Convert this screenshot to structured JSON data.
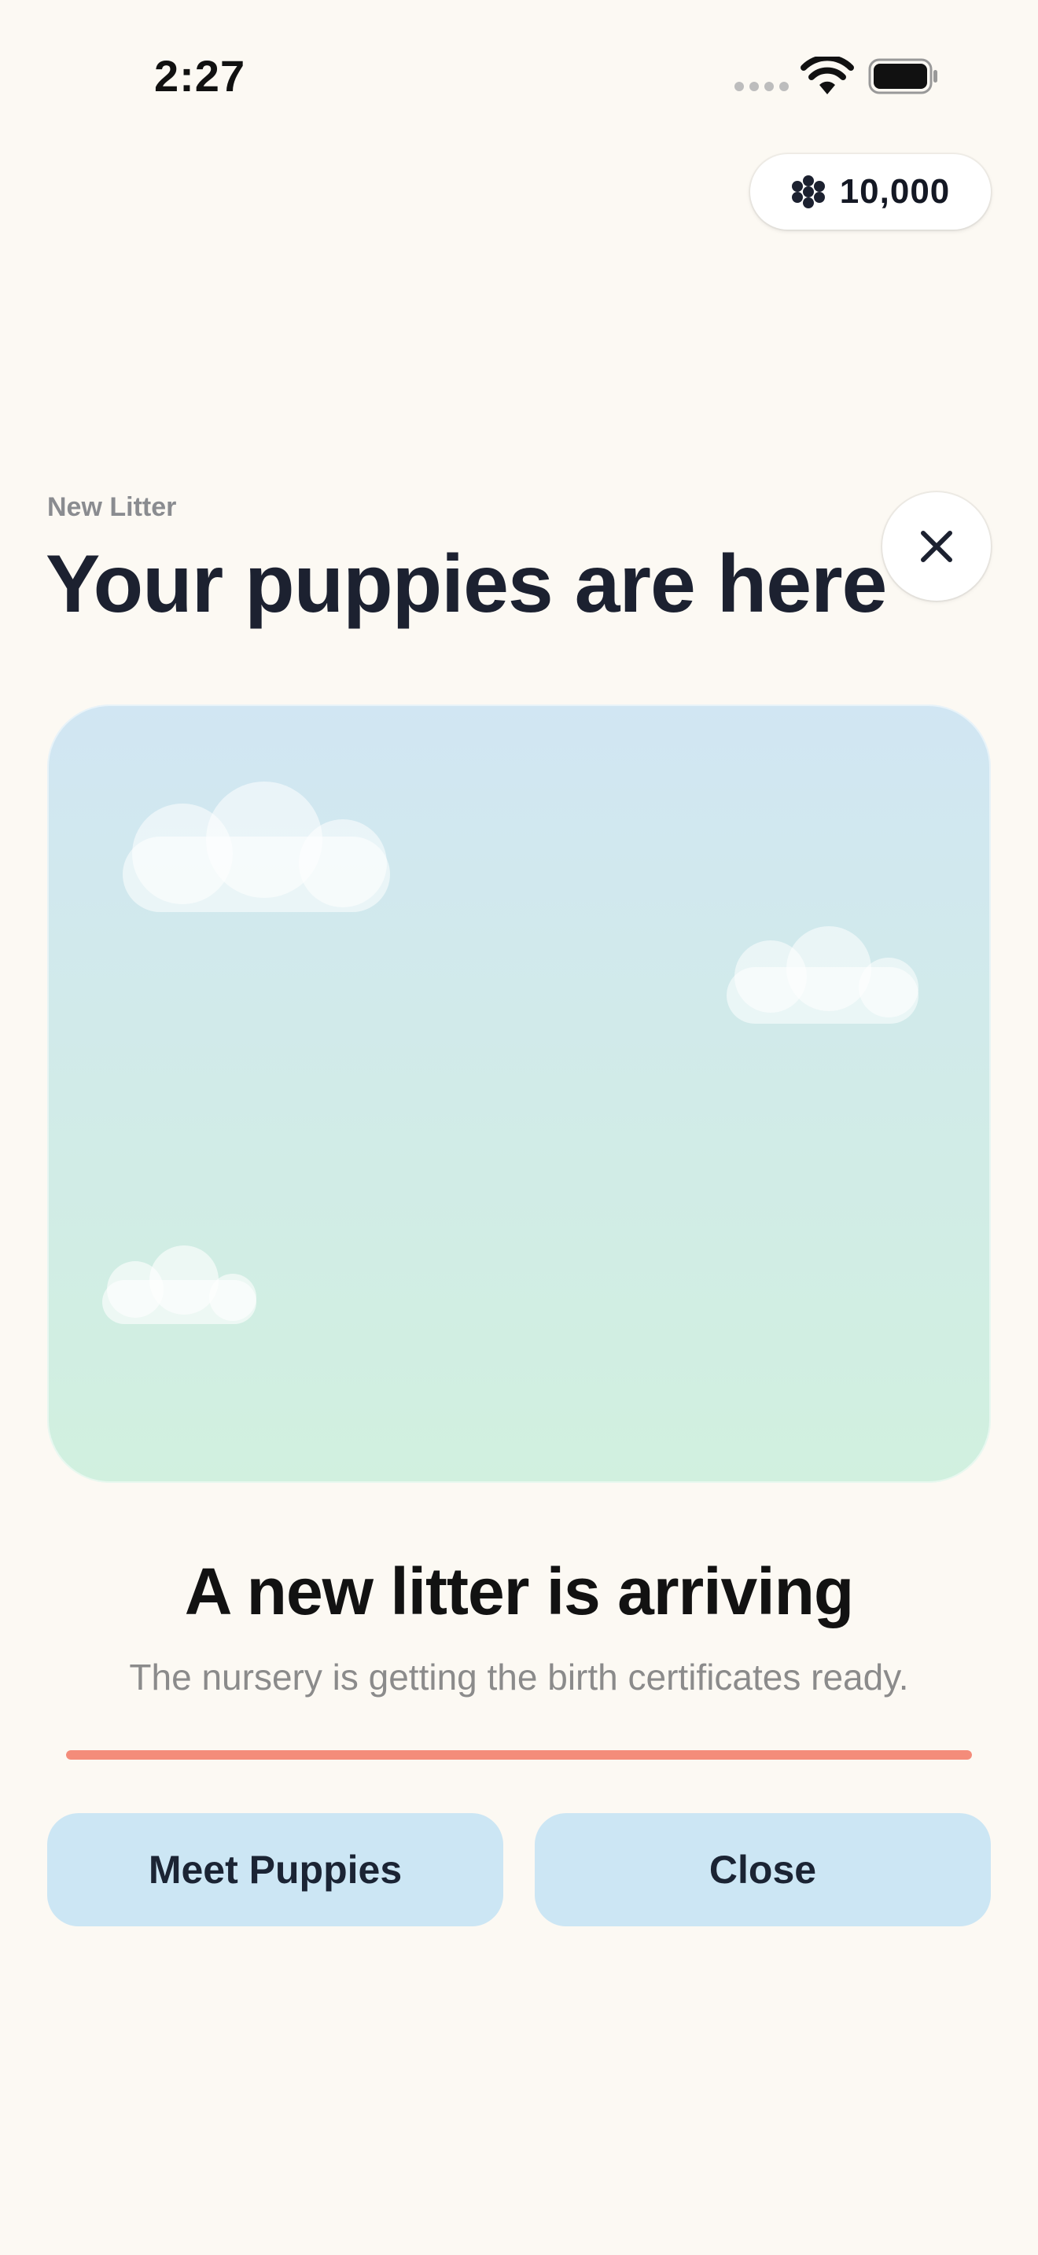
{
  "status_bar": {
    "time": "2:27"
  },
  "currency": {
    "amount": "10,000",
    "icon": "paw-coin-icon"
  },
  "header": {
    "eyebrow": "New Litter",
    "title": "Your puppies are here"
  },
  "status": {
    "headline": "A new litter is arriving",
    "message": "The nursery is getting the birth certificates ready.",
    "progress": 1.0
  },
  "actions": {
    "primary_label": "Meet Puppies",
    "secondary_label": "Close"
  },
  "colors": {
    "background": "#FCF9F3",
    "accent_progress": "#F48C7A",
    "button": "#CCE6F4",
    "sky_top": "#D1E6F3",
    "sky_bottom": "#D1F0DF"
  }
}
